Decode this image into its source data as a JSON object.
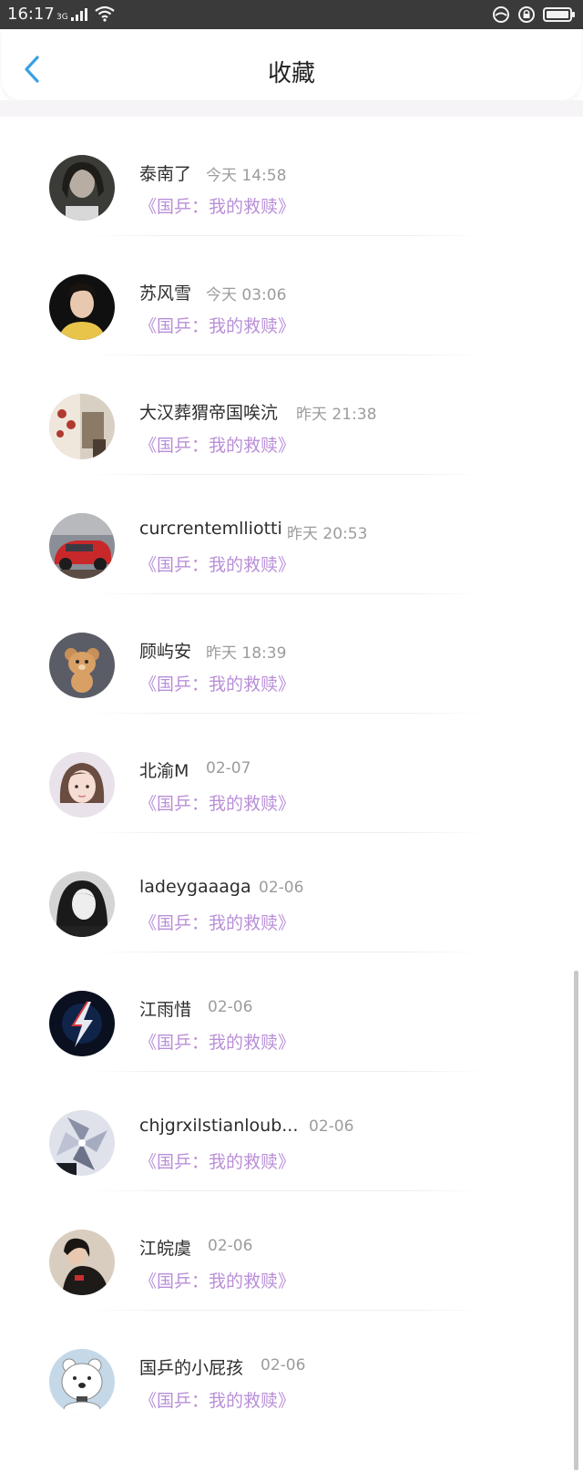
{
  "status_bar": {
    "time": "16:17",
    "network": "3G"
  },
  "header": {
    "title": "收藏"
  },
  "colors": {
    "accent": "#3a9fe6",
    "subtitle": "#b98fd8",
    "name": "#2d2d2d",
    "time": "#9c9c9c"
  },
  "items": [
    {
      "name": "泰南了",
      "time": "今天 14:58",
      "subtitle": "《国乒：我的救赎》"
    },
    {
      "name": "苏风雪",
      "time": "今天 03:06",
      "subtitle": "《国乒：我的救赎》"
    },
    {
      "name": "大汉葬猬帝国唉沆",
      "time": "昨天 21:38",
      "subtitle": "《国乒：我的救赎》"
    },
    {
      "name": "curcrentemlliotti",
      "time": "昨天 20:53",
      "subtitle": "《国乒：我的救赎》"
    },
    {
      "name": "顾屿安",
      "time": "昨天 18:39",
      "subtitle": "《国乒：我的救赎》"
    },
    {
      "name": "北渝M",
      "time": "02-07",
      "subtitle": "《国乒：我的救赎》"
    },
    {
      "name": "ladeygaaaga",
      "time": "02-06",
      "subtitle": "《国乒：我的救赎》"
    },
    {
      "name": "江雨惜",
      "time": "02-06",
      "subtitle": "《国乒：我的救赎》"
    },
    {
      "name": "chjgrxilstianloub...",
      "time": "02-06",
      "subtitle": "《国乒：我的救赎》"
    },
    {
      "name": "江皖虞",
      "time": "02-06",
      "subtitle": "《国乒：我的救赎》"
    },
    {
      "name": "国乒的小屁孩",
      "time": "02-06",
      "subtitle": "《国乒：我的救赎》"
    }
  ]
}
